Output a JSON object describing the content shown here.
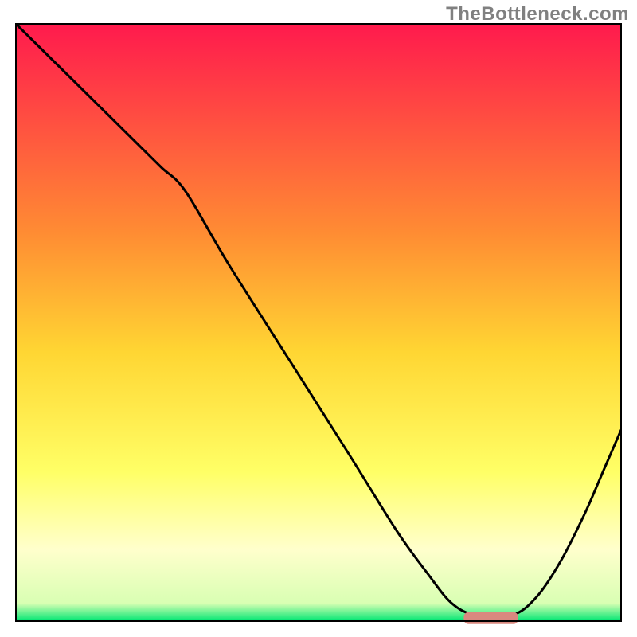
{
  "watermark": "TheBottleneck.com",
  "chart_data": {
    "type": "line",
    "title": "",
    "xlabel": "",
    "ylabel": "",
    "xlim": [
      0,
      100
    ],
    "ylim": [
      0,
      100
    ],
    "grid": false,
    "legend": false,
    "background_gradient": {
      "stops": [
        {
          "offset": 0,
          "color": "#ff1a4d"
        },
        {
          "offset": 35,
          "color": "#ff8c33"
        },
        {
          "offset": 55,
          "color": "#ffd633"
        },
        {
          "offset": 75,
          "color": "#ffff66"
        },
        {
          "offset": 88,
          "color": "#ffffcc"
        },
        {
          "offset": 97,
          "color": "#d9ffb3"
        },
        {
          "offset": 100,
          "color": "#00e673"
        }
      ]
    },
    "series": [
      {
        "name": "bottleneck-curve",
        "color": "#000000",
        "x": [
          0,
          5,
          10,
          15,
          20,
          24,
          28,
          35,
          45,
          55,
          63,
          68,
          72,
          76,
          82,
          86,
          90,
          94,
          97,
          100
        ],
        "y": [
          100,
          95,
          90,
          85,
          80,
          76,
          72,
          60,
          44,
          28,
          15,
          8,
          3,
          1,
          1,
          4,
          10,
          18,
          25,
          32
        ]
      }
    ],
    "marker": {
      "name": "optimal-range",
      "color": "#d9887f",
      "x_start": 74,
      "x_end": 83,
      "y": 0.5,
      "height": 2
    },
    "border_color": "#000000",
    "border_width": 2
  }
}
